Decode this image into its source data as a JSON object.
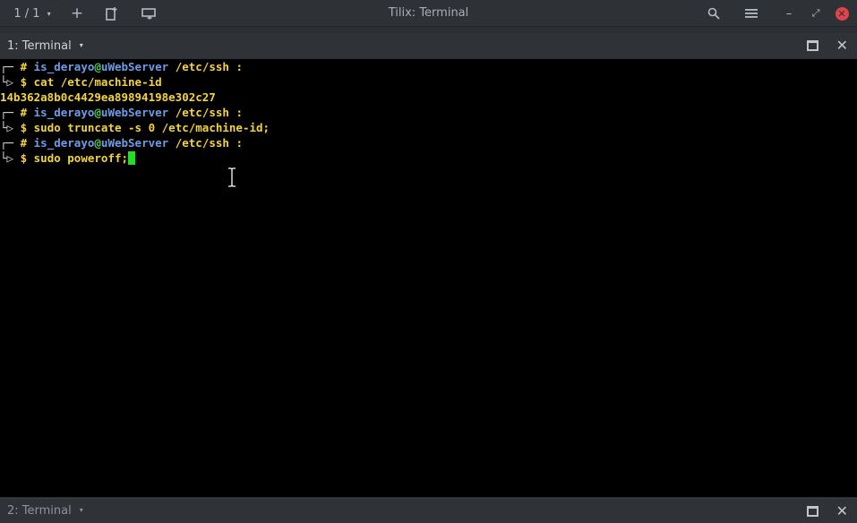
{
  "header": {
    "session_indicator": "1 / 1",
    "title": "Tilix: Terminal",
    "icons": {
      "caret": "▾",
      "add": "+",
      "split_horizontal": "split-horizontal-icon",
      "split_vertical": "split-vertical-icon",
      "search": "search-icon",
      "menu": "hamburger-menu-icon",
      "minimize": "–",
      "restore": "⤢",
      "close": "✕"
    }
  },
  "terminals": [
    {
      "label": "1: Terminal",
      "active": true
    },
    {
      "label": "2: Terminal",
      "active": false
    }
  ],
  "terminal_lines": {
    "p1_user": "is_derayo",
    "p1_host": "uWebServer",
    "p1_path": "/etc/ssh",
    "cmd1": "cat /etc/machine-id",
    "out1": "14b362a8b0c4429ea89894198e302c27",
    "p2_user": "is_derayo",
    "p2_host": "uWebServer",
    "p2_path": "/etc/ssh",
    "cmd2": "sudo truncate -s 0 /etc/machine-id;",
    "p3_user": "is_derayo",
    "p3_host": "uWebServer",
    "p3_path": "/etc/ssh",
    "cmd3": "sudo poweroff;"
  },
  "symbols": {
    "hash": "#",
    "at": "@",
    "colon": ":",
    "dollar": "$",
    "tree_top": "┌─",
    "tree_bottom": "└▷"
  },
  "colors": {
    "prompt_yellow": "#f5d33a",
    "prompt_blue": "#6d9de6",
    "prompt_green": "#4fcf50",
    "cursor": "#21e021",
    "close_red": "#e0434b",
    "terminal_bg": "#000000"
  }
}
